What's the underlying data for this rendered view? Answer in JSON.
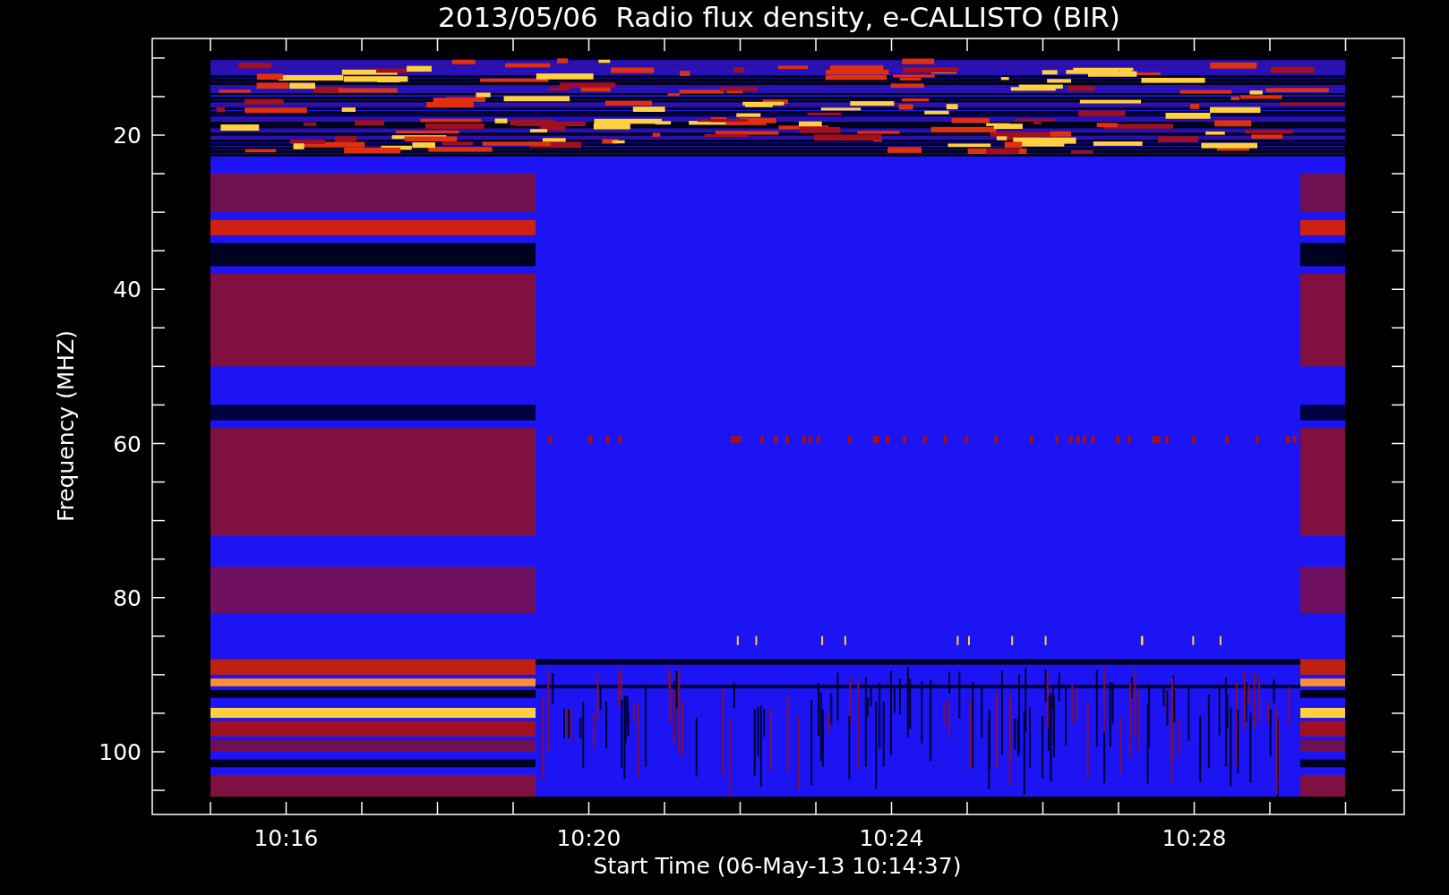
{
  "title": "2013/05/06  Radio flux density, e-CALLISTO (BIR)",
  "y_axis": {
    "label": "Frequency (MHZ)",
    "tick_labels": [
      "20",
      "40",
      "60",
      "80",
      "100"
    ]
  },
  "x_axis": {
    "label": "Start Time (06-May-13 10:14:37)",
    "tick_labels": [
      "10:16",
      "10:20",
      "10:24",
      "10:28"
    ]
  }
}
